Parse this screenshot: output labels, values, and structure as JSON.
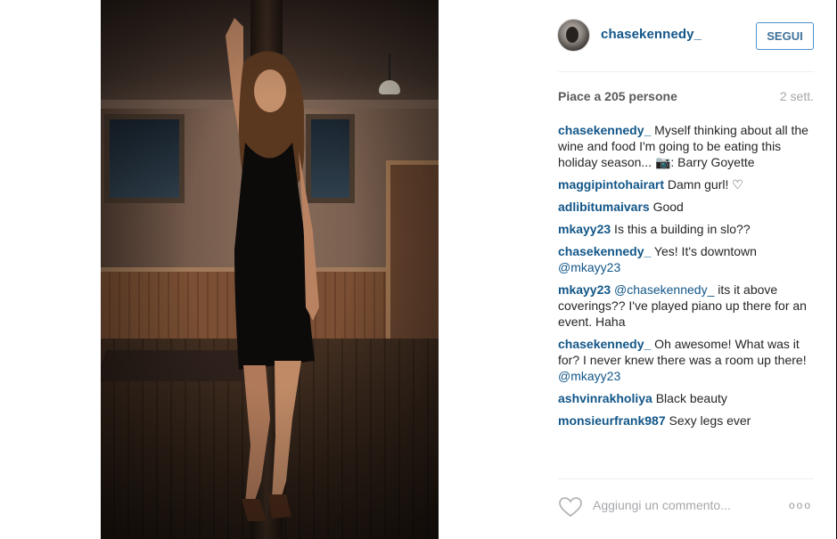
{
  "post": {
    "photo_alt": "Photo by chasekennedy_",
    "author": {
      "username": "chasekennedy_",
      "follow_label": "SEGUI"
    },
    "likes_text": "Piace a 205 persone",
    "time_ago": "2 sett.",
    "comments": [
      {
        "user": "chasekennedy_",
        "text": " Myself thinking about all the wine and food I'm going to be eating this holiday season... 📷: Barry Goyette"
      },
      {
        "user": "maggipintohairart",
        "text": " Damn gurl! ♡"
      },
      {
        "user": "adlibitumaivars",
        "text": " Good"
      },
      {
        "user": "mkayy23",
        "text": " Is this a building in slo??"
      },
      {
        "user": "chasekennedy_",
        "text": " Yes! It's downtown ",
        "mention": "@mkayy23"
      },
      {
        "user": "mkayy23",
        "mention_lead": " @chasekennedy_",
        "text": " its it above coverings?? I've played piano up there for an event. Haha"
      },
      {
        "user": "chasekennedy_",
        "text": " Oh awesome! What was it for? I never knew there was a room up there! ",
        "mention": "@mkayy23"
      },
      {
        "user": "ashvinrakholiya",
        "text": " Black beauty"
      },
      {
        "user": "monsieurfrank987",
        "text": " Sexy legs ever"
      }
    ],
    "add_comment_placeholder": "Aggiungi un commento...",
    "more_label": "ooo"
  },
  "icons": {
    "like": "heart-outline-icon",
    "options": "more-options-icon"
  },
  "colors": {
    "link": "#125688",
    "follow_border": "#4e8fd1",
    "muted": "#a5a7aa"
  }
}
